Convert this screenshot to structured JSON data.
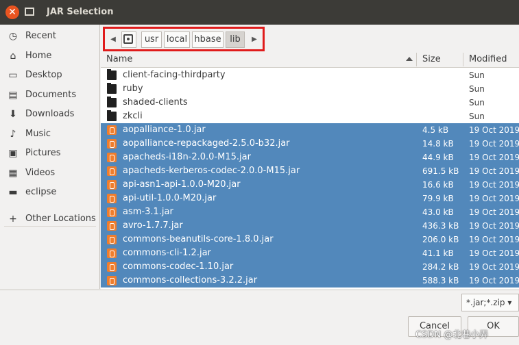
{
  "window": {
    "title": "JAR Selection"
  },
  "sidebar": {
    "items": [
      {
        "label": "Recent",
        "icon": "clock-icon"
      },
      {
        "label": "Home",
        "icon": "home-icon"
      },
      {
        "label": "Desktop",
        "icon": "desktop-icon"
      },
      {
        "label": "Documents",
        "icon": "documents-icon"
      },
      {
        "label": "Downloads",
        "icon": "downloads-icon"
      },
      {
        "label": "Music",
        "icon": "music-icon"
      },
      {
        "label": "Pictures",
        "icon": "pictures-icon"
      },
      {
        "label": "Videos",
        "icon": "videos-icon"
      },
      {
        "label": "eclipse",
        "icon": "folder-icon"
      }
    ],
    "other": {
      "label": "Other Locations",
      "icon": "plus-icon"
    }
  },
  "pathbar": {
    "segments": [
      "usr",
      "local",
      "hbase",
      "lib"
    ],
    "active_segment": "lib",
    "highlight_color": "#e01b1b"
  },
  "columns": {
    "name": "Name",
    "size": "Size",
    "modified": "Modified"
  },
  "files": [
    {
      "name": "client-facing-thirdparty",
      "size": "",
      "modified": "Sun",
      "type": "folder",
      "selected": false
    },
    {
      "name": "ruby",
      "size": "",
      "modified": "Sun",
      "type": "folder",
      "selected": false
    },
    {
      "name": "shaded-clients",
      "size": "",
      "modified": "Sun",
      "type": "folder",
      "selected": false
    },
    {
      "name": "zkcli",
      "size": "",
      "modified": "Sun",
      "type": "folder",
      "selected": false
    },
    {
      "name": "aopalliance-1.0.jar",
      "size": "4.5 kB",
      "modified": "19 Oct 2019",
      "type": "jar",
      "selected": true
    },
    {
      "name": "aopalliance-repackaged-2.5.0-b32.jar",
      "size": "14.8 kB",
      "modified": "19 Oct 2019",
      "type": "jar",
      "selected": true
    },
    {
      "name": "apacheds-i18n-2.0.0-M15.jar",
      "size": "44.9 kB",
      "modified": "19 Oct 2019",
      "type": "jar",
      "selected": true
    },
    {
      "name": "apacheds-kerberos-codec-2.0.0-M15.jar",
      "size": "691.5 kB",
      "modified": "19 Oct 2019",
      "type": "jar",
      "selected": true
    },
    {
      "name": "api-asn1-api-1.0.0-M20.jar",
      "size": "16.6 kB",
      "modified": "19 Oct 2019",
      "type": "jar",
      "selected": true
    },
    {
      "name": "api-util-1.0.0-M20.jar",
      "size": "79.9 kB",
      "modified": "19 Oct 2019",
      "type": "jar",
      "selected": true
    },
    {
      "name": "asm-3.1.jar",
      "size": "43.0 kB",
      "modified": "19 Oct 2019",
      "type": "jar",
      "selected": true
    },
    {
      "name": "avro-1.7.7.jar",
      "size": "436.3 kB",
      "modified": "19 Oct 2019",
      "type": "jar",
      "selected": true
    },
    {
      "name": "commons-beanutils-core-1.8.0.jar",
      "size": "206.0 kB",
      "modified": "19 Oct 2019",
      "type": "jar",
      "selected": true
    },
    {
      "name": "commons-cli-1.2.jar",
      "size": "41.1 kB",
      "modified": "19 Oct 2019",
      "type": "jar",
      "selected": true
    },
    {
      "name": "commons-codec-1.10.jar",
      "size": "284.2 kB",
      "modified": "19 Oct 2019",
      "type": "jar",
      "selected": true
    },
    {
      "name": "commons-collections-3.2.2.jar",
      "size": "588.3 kB",
      "modified": "19 Oct 2019",
      "type": "jar",
      "selected": true
    }
  ],
  "filter": {
    "label": "*.jar;*.zip ▾"
  },
  "buttons": {
    "cancel": "Cancel",
    "ok": "OK"
  },
  "watermark": "CSDN @北巷小弄",
  "colors": {
    "selection": "#5288bb",
    "titlebar": "#3c3b37",
    "close": "#e95420",
    "jar_icon": "#f07d2c"
  }
}
